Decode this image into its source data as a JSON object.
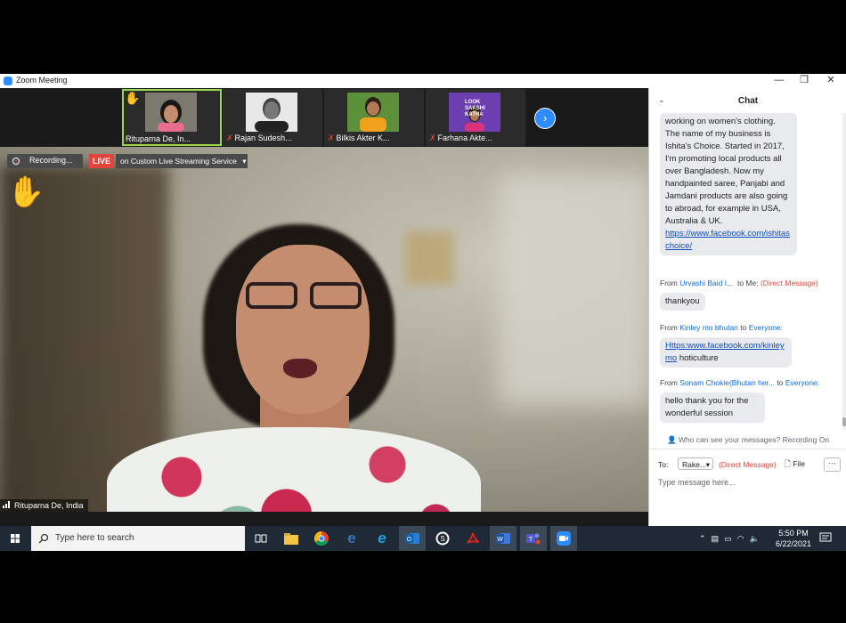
{
  "window": {
    "title": "Zoom Meeting",
    "controls": {
      "minimize": "—",
      "restore": "❐",
      "close": "✕"
    }
  },
  "colors": {
    "zoom_blue": "#2d8cff",
    "live_red": "#e0443a",
    "active_border": "#9ad64e",
    "taskbar": "#1f2a36"
  },
  "participants": [
    {
      "name": "Rituparna De, In...",
      "muted": false,
      "hand_raised": true,
      "active": true
    },
    {
      "name": "Rajan Sudesh...",
      "muted": true,
      "hand_raised": false,
      "active": false
    },
    {
      "name": "Bilkis Akter K...",
      "muted": true,
      "hand_raised": false,
      "active": false
    },
    {
      "name": "Farhana Akte...",
      "muted": true,
      "hand_raised": false,
      "active": false
    }
  ],
  "participant_thumbs": {
    "fourth_banner": "LOOK SAKSHI KATHA"
  },
  "status": {
    "recording": "Recording...",
    "live": "LIVE",
    "live_service": "on Custom Live Streaming Service"
  },
  "main_video": {
    "speaker_name": "Rituparna De, India"
  },
  "chat": {
    "title": "Chat",
    "messages": [
      {
        "text": "working on women's clothing. The name of my business is Ishita's Choice. Started in 2017, I'm promoting local products all over Bangladesh. Now my handpainted saree, Panjabi and Jamdani products are also going to abroad, for example in USA, Australia & UK.",
        "link": "https://www.facebook.com/ishitaschoice/"
      },
      {
        "from_prefix": "From",
        "from": "Urvashi Baid I...",
        "to_prefix": "to",
        "to": "Me:",
        "dm": "(Direct Message)",
        "text": "thankyou"
      },
      {
        "from_prefix": "From",
        "from": "Kinley mo bhutan",
        "to_prefix": "to",
        "to": "Everyone:",
        "link": "Https:www.facebook.com/kinleymo",
        "text": "hoticulture"
      },
      {
        "from_prefix": "From",
        "from": "Sonam Chokie(Bhutan her...",
        "to_prefix": "to",
        "to": "Everyone:",
        "text": "hello thank you for the wonderful session"
      }
    ],
    "who_can_see": "Who can see your messages? Recording On",
    "to_label": "To:",
    "to_value": "Rake...",
    "to_dm": "(Direct Message)",
    "file_label": "File",
    "more_label": "···",
    "placeholder": "Type message here..."
  },
  "taskbar": {
    "search_placeholder": "Type here to search",
    "time": "5:50 PM",
    "date": "6/22/2021",
    "apps": [
      "task-view",
      "file-explorer",
      "chrome",
      "edge",
      "internet-explorer",
      "outlook",
      "skype",
      "acrobat",
      "word",
      "teams",
      "zoom"
    ]
  }
}
